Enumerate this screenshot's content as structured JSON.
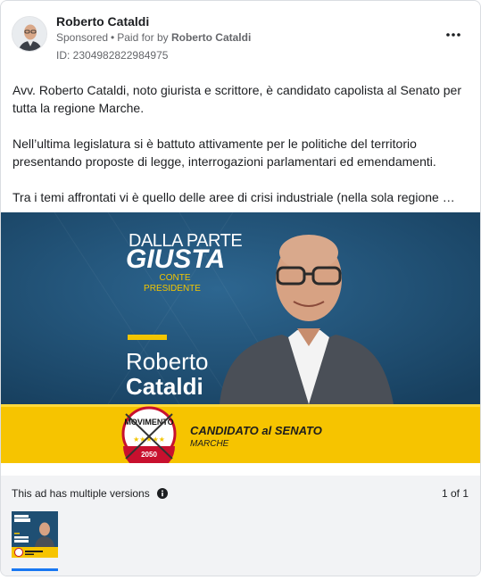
{
  "post": {
    "page_name": "Roberto Cataldi",
    "sponsored": "Sponsored",
    "paid_for_prefix": "Paid for by",
    "payer": "Roberto Cataldi",
    "ad_id": "ID: 2304982822984975",
    "more_icon": "more-horizontal-icon"
  },
  "ad_text": {
    "p1": "Avv. Roberto Cataldi, noto giurista e scrittore, è candidato capolista al Senato per tutta la regione Marche.",
    "p2": "Nell’ultima legislatura si è battuto attivamente per le politiche del territorio presentando proposte di legge, interrogazioni parlamentari ed emendamenti.",
    "p3": "Tra i temi affrontati vi è quello delle aree di crisi industriale (nella sola regione …"
  },
  "creative": {
    "slogan_top": "DALLA PARTE",
    "slogan_main": "GIUSTA",
    "slogan_sub1": "CONTE",
    "slogan_sub2": "PRESIDENTE",
    "first_name": "Roberto",
    "last_name": "Cataldi",
    "logo_word": "MOVIMENTO",
    "logo_year": "2050",
    "candidacy": "CANDIDATO al SENATO",
    "region": "MARCHE",
    "colors": {
      "background": "#1f4f73",
      "band": "#f6c400",
      "slogan_yellow": "#f2c500",
      "logo_red": "#c8102e"
    }
  },
  "footer": {
    "versions_label": "This ad has multiple versions",
    "info_icon": "info-icon",
    "pager": "1 of 1",
    "thumb_label": "ad-version-thumbnail"
  },
  "colors": {
    "muted_text": "#65676b",
    "accent": "#1877f2",
    "footer_bg": "#f2f3f5"
  }
}
